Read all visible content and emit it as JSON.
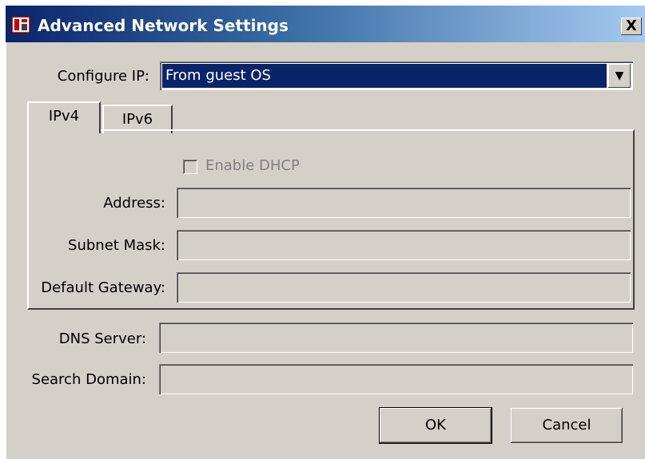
{
  "window": {
    "title": "Advanced Network Settings",
    "close_label": "X",
    "icon": "network-app-icon",
    "titlebar_colors": [
      "#0a246a",
      "#a6caf0"
    ]
  },
  "configure_ip": {
    "label": "Configure IP:",
    "selected": "From guest OS",
    "arrow": "▼"
  },
  "tabs": [
    {
      "label": "IPv4",
      "active": true
    },
    {
      "label": "IPv6",
      "active": false
    }
  ],
  "ipv4": {
    "dhcp_label": "Enable DHCP",
    "dhcp_checked": false,
    "address_label": "Address:",
    "address_value": "",
    "subnet_label": "Subnet Mask:",
    "subnet_value": "",
    "gateway_label": "Default Gateway:",
    "gateway_value": ""
  },
  "dns": {
    "label": "DNS Server:",
    "value": ""
  },
  "search_domain": {
    "label": "Search Domain:",
    "value": ""
  },
  "buttons": {
    "ok": "OK",
    "cancel": "Cancel"
  }
}
